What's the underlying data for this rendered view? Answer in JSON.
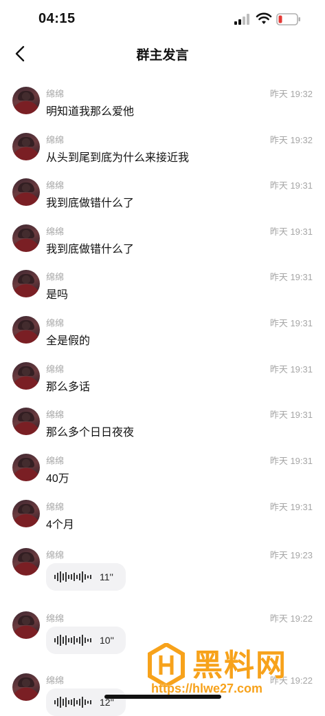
{
  "status_bar": {
    "time": "04:15"
  },
  "nav": {
    "title": "群主发言"
  },
  "messages": [
    {
      "sender": "绵绵",
      "time": "昨天 19:32",
      "type": "text",
      "content": "明知道我那么爱他"
    },
    {
      "sender": "绵绵",
      "time": "昨天 19:32",
      "type": "text",
      "content": "从头到尾到底为什么来接近我"
    },
    {
      "sender": "绵绵",
      "time": "昨天 19:31",
      "type": "text",
      "content": "我到底做错什么了"
    },
    {
      "sender": "绵绵",
      "time": "昨天 19:31",
      "type": "text",
      "content": "我到底做错什么了"
    },
    {
      "sender": "绵绵",
      "time": "昨天 19:31",
      "type": "text",
      "content": "是吗"
    },
    {
      "sender": "绵绵",
      "time": "昨天 19:31",
      "type": "text",
      "content": "全是假的"
    },
    {
      "sender": "绵绵",
      "time": "昨天 19:31",
      "type": "text",
      "content": "那么多话"
    },
    {
      "sender": "绵绵",
      "time": "昨天 19:31",
      "type": "text",
      "content": "那么多个日日夜夜"
    },
    {
      "sender": "绵绵",
      "time": "昨天 19:31",
      "type": "text",
      "content": "40万"
    },
    {
      "sender": "绵绵",
      "time": "昨天 19:31",
      "type": "text",
      "content": "4个月"
    },
    {
      "sender": "绵绵",
      "time": "昨天 19:23",
      "type": "voice",
      "content": "11''"
    },
    {
      "sender": "绵绵",
      "time": "昨天 19:22",
      "type": "voice",
      "content": "10''"
    },
    {
      "sender": "绵绵",
      "time": "昨天 19:22",
      "type": "voice",
      "content": "12''"
    }
  ],
  "watermark": {
    "title": "黑料网",
    "url": "https://hlwe27.com"
  }
}
